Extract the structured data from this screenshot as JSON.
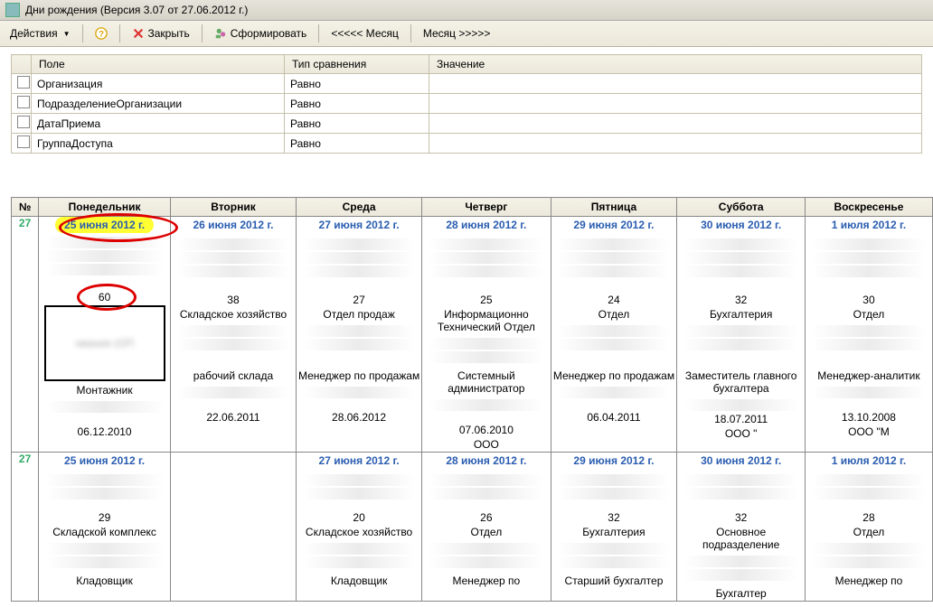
{
  "window": {
    "title": "Дни рождения (Версия 3.07 от 27.06.2012 г.)"
  },
  "toolbar": {
    "actions": "Действия",
    "close": "Закрыть",
    "generate": "Сформировать",
    "month_prev": "<<<<< Месяц",
    "month_next": "Месяц >>>>>"
  },
  "filter": {
    "headers": {
      "field": "Поле",
      "cmp": "Тип сравнения",
      "val": "Значение"
    },
    "rows": [
      {
        "field": "Организация",
        "cmp": "Равно",
        "val": ""
      },
      {
        "field": "ПодразделениеОрганизации",
        "cmp": "Равно",
        "val": ""
      },
      {
        "field": "ДатаПриема",
        "cmp": "Равно",
        "val": ""
      },
      {
        "field": "ГруппаДоступа",
        "cmp": "Равно",
        "val": ""
      }
    ]
  },
  "calendar": {
    "week_col": "№",
    "days": [
      "Понедельник",
      "Вторник",
      "Среда",
      "Четверг",
      "Пятница",
      "Суббота",
      "Воскресенье"
    ],
    "week1": {
      "num": "27",
      "cells": [
        {
          "date": "25 июня 2012 г.",
          "age": "60",
          "dept": "",
          "role": "Монтажник",
          "hired": "06.12.2010",
          "today": true
        },
        {
          "date": "26 июня 2012 г.",
          "age": "38",
          "dept": "Складское хозяйство",
          "role": "рабочий склада",
          "hired": "22.06.2011"
        },
        {
          "date": "27 июня 2012 г.",
          "age": "27",
          "dept": "Отдел продаж",
          "role": "Менеджер по продажам",
          "hired": "28.06.2012"
        },
        {
          "date": "28 июня 2012 г.",
          "age": "25",
          "dept": "Информационно Технический Отдел",
          "role": "Системный администратор",
          "hired": "07.06.2010",
          "org": "ООО"
        },
        {
          "date": "29 июня 2012 г.",
          "age": "24",
          "dept": "Отдел",
          "role": "Менеджер по продажам",
          "hired": "06.04.2011"
        },
        {
          "date": "30 июня 2012 г.",
          "age": "32",
          "dept": "Бухгалтерия",
          "role": "Заместитель главного бухгалтера",
          "hired": "18.07.2011",
          "org": "ООО \""
        },
        {
          "date": "1 июля 2012 г.",
          "age": "30",
          "dept": "Отдел",
          "role": "Менеджер-аналитик",
          "hired": "13.10.2008",
          "org": "ООО \"М"
        }
      ]
    },
    "week2": {
      "num": "27",
      "cells": [
        {
          "date": "25 июня 2012 г.",
          "age": "29",
          "dept": "Складской комплекс",
          "role": "Кладовщик"
        },
        {
          "date": "",
          "age": "",
          "dept": "",
          "role": ""
        },
        {
          "date": "27 июня 2012 г.",
          "age": "20",
          "dept": "Складское хозяйство",
          "role": "Кладовщик"
        },
        {
          "date": "28 июня 2012 г.",
          "age": "26",
          "dept": "Отдел",
          "role": "Менеджер по"
        },
        {
          "date": "29 июня 2012 г.",
          "age": "32",
          "dept": "Бухгалтерия",
          "role": "Старший бухгалтер"
        },
        {
          "date": "30 июня 2012 г.",
          "age": "32",
          "dept": "Основное подразделение",
          "role": "Бухгалтер"
        },
        {
          "date": "1 июля 2012 г.",
          "age": "28",
          "dept": "Отдел",
          "role": "Менеджер по"
        }
      ]
    }
  }
}
